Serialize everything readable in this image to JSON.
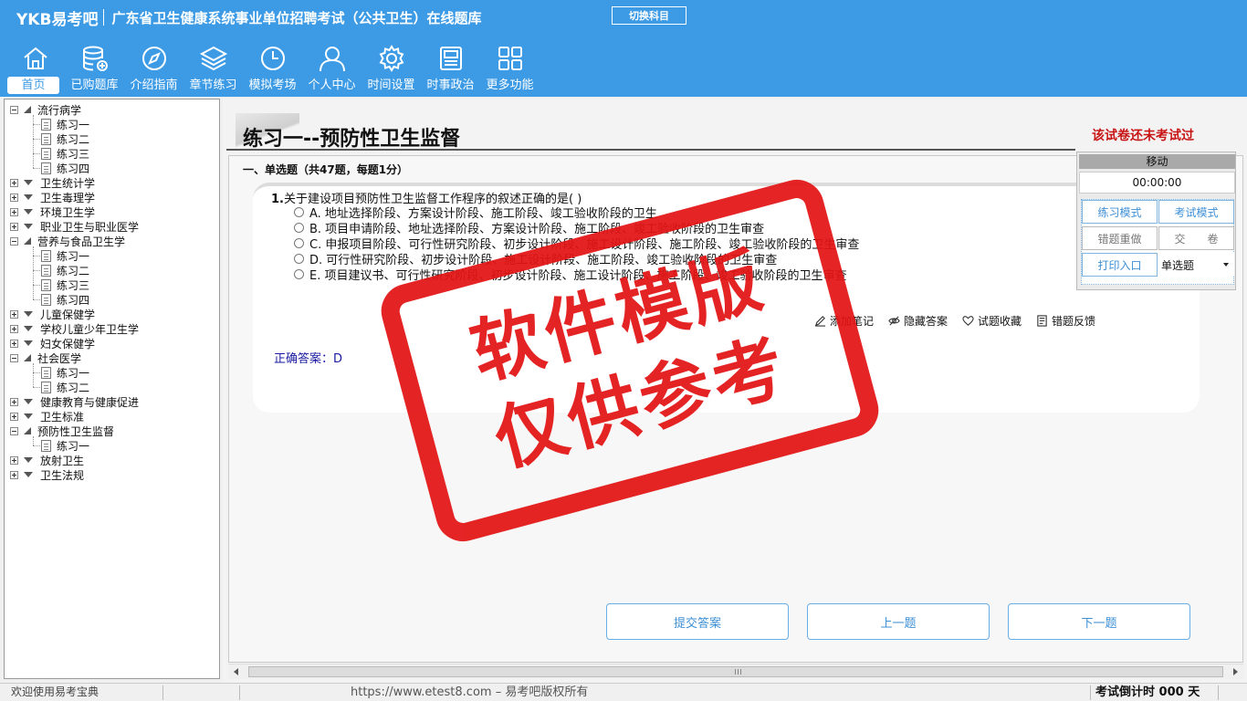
{
  "header": {
    "logo": "YKB易考吧",
    "app_title": "广东省卫生健康系统事业单位招聘考试（公共卫生）在线题库",
    "switch_label": "切换科目",
    "nav": [
      {
        "label": "首页",
        "icon": "home-icon",
        "active": true
      },
      {
        "label": "已购题库",
        "icon": "database-icon"
      },
      {
        "label": "介绍指南",
        "icon": "compass-icon"
      },
      {
        "label": "章节练习",
        "icon": "layers-icon"
      },
      {
        "label": "模拟考场",
        "icon": "clock-icon"
      },
      {
        "label": "个人中心",
        "icon": "user-icon"
      },
      {
        "label": "时间设置",
        "icon": "gear-icon"
      },
      {
        "label": "时事政治",
        "icon": "news-icon"
      },
      {
        "label": "更多功能",
        "icon": "grid-icon"
      }
    ]
  },
  "tree": {
    "items": [
      {
        "label": "流行病学",
        "level": 0,
        "expanded": true
      },
      {
        "label": "练习一",
        "level": 1
      },
      {
        "label": "练习二",
        "level": 1
      },
      {
        "label": "练习三",
        "level": 1
      },
      {
        "label": "练习四",
        "level": 1
      },
      {
        "label": "卫生统计学",
        "level": 0,
        "expanded": false
      },
      {
        "label": "卫生毒理学",
        "level": 0,
        "expanded": false
      },
      {
        "label": "环境卫生学",
        "level": 0,
        "expanded": false
      },
      {
        "label": "职业卫生与职业医学",
        "level": 0,
        "expanded": false
      },
      {
        "label": "营养与食品卫生学",
        "level": 0,
        "expanded": true
      },
      {
        "label": "练习一",
        "level": 1
      },
      {
        "label": "练习二",
        "level": 1
      },
      {
        "label": "练习三",
        "level": 1
      },
      {
        "label": "练习四",
        "level": 1
      },
      {
        "label": "儿童保健学",
        "level": 0,
        "expanded": false
      },
      {
        "label": "学校儿童少年卫生学",
        "level": 0,
        "expanded": false
      },
      {
        "label": "妇女保健学",
        "level": 0,
        "expanded": false
      },
      {
        "label": "社会医学",
        "level": 0,
        "expanded": true
      },
      {
        "label": "练习一",
        "level": 1
      },
      {
        "label": "练习二",
        "level": 1
      },
      {
        "label": "健康教育与健康促进",
        "level": 0,
        "expanded": false
      },
      {
        "label": "卫生标准",
        "level": 0,
        "expanded": false
      },
      {
        "label": "预防性卫生监督",
        "level": 0,
        "expanded": true
      },
      {
        "label": "练习一",
        "level": 1,
        "selected": true
      },
      {
        "label": "放射卫生",
        "level": 0,
        "expanded": false
      },
      {
        "label": "卫生法规",
        "level": 0,
        "expanded": false
      }
    ]
  },
  "main": {
    "page_title": "练习一--预防性卫生监督",
    "exam_status": "该试卷还未考试过",
    "section_title": "一、单选题（共47题，每题1分）",
    "question": {
      "number": "1.",
      "stem": "关于建设项目预防性卫生监督工作程序的叙述正确的是( )",
      "options": [
        "A. 地址选择阶段、方案设计阶段、施工阶段、竣工验收阶段的卫生",
        "B. 项目申请阶段、地址选择阶段、方案设计阶段、施工阶段、竣工验收阶段的卫生审查",
        "C. 申报项目阶段、可行性研究阶段、初步设计阶段、施工设计阶段、施工阶段、竣工验收阶段的卫生审查",
        "D. 可行性研究阶段、初步设计阶段、施工设计阶段、施工阶段、竣工验收阶段的卫生审查",
        "E. 项目建议书、可行性研究阶段、初步设计阶段、施工设计阶段、施工阶段、竣工验收阶段的卫生审查"
      ],
      "actions": [
        "添加笔记",
        "隐藏答案",
        "试题收藏",
        "错题反馈"
      ],
      "answer": "正确答案：D"
    },
    "buttons": {
      "submit": "提交答案",
      "prev": "上一题",
      "next": "下一题"
    }
  },
  "control_panel": {
    "move_label": "移动",
    "timer": "00:00:00",
    "practice_mode": "练习模式",
    "exam_mode": "考试模式",
    "redo_wrong": "错题重做",
    "hand_in": "交　　卷",
    "print": "打印入口",
    "question_type": "单选题"
  },
  "statusbar": {
    "welcome": "欢迎使用易考宝典",
    "copyright": "https://www.etest8.com – 易考吧版权所有",
    "countdown": "考试倒计时 000 天"
  },
  "watermark": {
    "line1": "软件模版",
    "line2": "仅供参考"
  },
  "colors": {
    "header_bg": "#3d9be6",
    "accent": "#3d8fd6",
    "status_red": "#c81414",
    "stamp_red": "#e31414"
  }
}
